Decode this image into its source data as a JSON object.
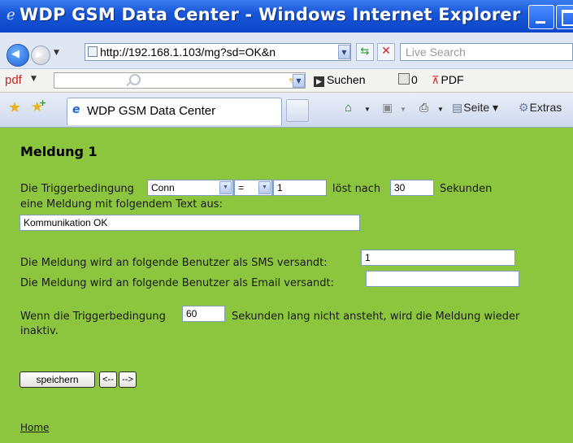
{
  "window": {
    "title": "WDP GSM Data Center - Windows Internet Explorer"
  },
  "addressbar": {
    "url": "http://192.168.1.103/mg?sd=OK&n",
    "search_placeholder": "Live Search"
  },
  "pdftoolbar": {
    "label": "pdf",
    "suchen": "Suchen",
    "count": "0",
    "pdf_button": "PDF"
  },
  "tabs": [
    {
      "label": "WDP GSM Data Center"
    }
  ],
  "commandbar": {
    "seite": "Seite",
    "extras": "Extras"
  },
  "form": {
    "heading": "Meldung 1",
    "trigger_label": "Die Triggerbedingung",
    "trigger_select": "Conn",
    "operator_select": "=",
    "trigger_value": "1",
    "loest_nach": "löst nach",
    "delay_value": "30",
    "sekunden": "Sekunden",
    "line2": "eine Meldung mit folgendem Text aus:",
    "message_text": "Kommunikation OK",
    "sms_label": "Die Meldung wird an folgende Benutzer als SMS versandt:",
    "sms_value": "1",
    "email_label": "Die Meldung wird an folgende Benutzer als Email versandt:",
    "email_value": "",
    "inactive_label_a": "Wenn die Triggerbedingung",
    "inactive_value": "60",
    "inactive_label_b": "Sekunden lang nicht ansteht, wird die Meldung wieder",
    "inactive_label_c": "inaktiv.",
    "save_button": "speichern",
    "prev_button": "<--",
    "next_button": "-->",
    "home_link": "Home"
  }
}
